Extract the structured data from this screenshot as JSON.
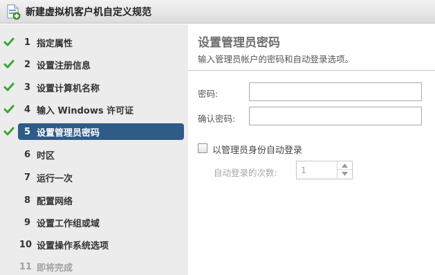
{
  "window": {
    "title": "新建虚拟机客户机自定义规范",
    "icon": "spec-document-icon"
  },
  "steps": [
    {
      "num": "1",
      "label": "指定属性",
      "state": "complete"
    },
    {
      "num": "2",
      "label": "设置注册信息",
      "state": "complete"
    },
    {
      "num": "3",
      "label": "设置计算机名称",
      "state": "complete"
    },
    {
      "num": "4",
      "label": "输入 Windows 许可证",
      "state": "complete"
    },
    {
      "num": "5",
      "label": "设置管理员密码",
      "state": "active"
    },
    {
      "num": "6",
      "label": "时区",
      "state": "pending"
    },
    {
      "num": "7",
      "label": "运行一次",
      "state": "pending"
    },
    {
      "num": "8",
      "label": "配置网络",
      "state": "pending"
    },
    {
      "num": "9",
      "label": "设置工作组或域",
      "state": "pending"
    },
    {
      "num": "10",
      "label": "设置操作系统选项",
      "state": "pending"
    },
    {
      "num": "11",
      "label": "即将完成",
      "state": "disabled"
    }
  ],
  "main": {
    "title": "设置管理员密码",
    "description": "输入管理员帐户的密码和自动登录选项。",
    "password_label": "密码:",
    "password_value": "",
    "confirm_label": "确认密码:",
    "confirm_value": "",
    "autologon_label": "以管理员身份自动登录",
    "autologon_checked": false,
    "autologon_count_label": "自动登录的次数:",
    "autologon_count_value": "1"
  },
  "colors": {
    "active_step": "#2f5b87",
    "check": "#3aa335",
    "sidebar_bg": "#ececec"
  }
}
